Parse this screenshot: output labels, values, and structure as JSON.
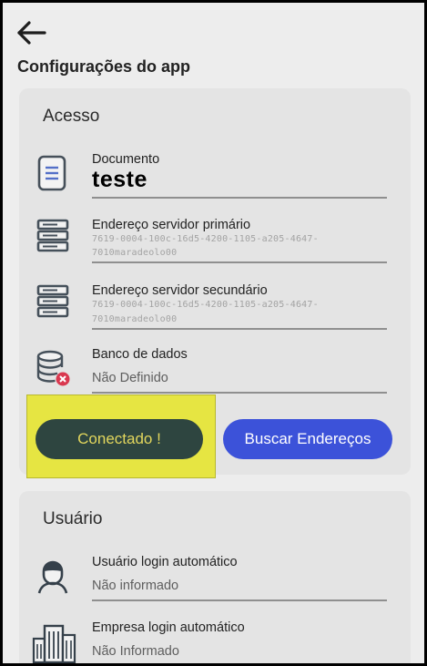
{
  "header": {
    "title": "Configurações do app"
  },
  "acesso": {
    "title": "Acesso",
    "documento": {
      "label": "Documento",
      "value": "teste"
    },
    "servidor_primario": {
      "label": "Endereço servidor primário",
      "masked_line1": "7619-0004-100c-16d5-4200-1105-a205-4647-",
      "masked_line2": "7010maradeolo00"
    },
    "servidor_secundario": {
      "label": "Endereço servidor secundário",
      "masked_line1": "7619-0004-100c-16d5-4200-1105-a205-4647-",
      "masked_line2": "7010maradeolo00"
    },
    "banco": {
      "label": "Banco de dados",
      "value": "Não Definido"
    },
    "buttons": {
      "connected": "Conectado !",
      "search": "Buscar Endereços"
    }
  },
  "usuario": {
    "title": "Usuário",
    "login_auto": {
      "label": "Usuário login automático",
      "value": "Não informado"
    },
    "empresa_auto": {
      "label": "Empresa login automático",
      "value": "Não Informado"
    }
  },
  "colors": {
    "connected_button": "#2e4540",
    "connected_text": "#e2d65d",
    "search_button": "#3c52d9",
    "highlight": "#e6e542",
    "card_bg": "#e4e4e4",
    "page_bg": "#ededed"
  },
  "icons": {
    "back": "arrow-left-icon",
    "documento": "document-icon",
    "servidor": "server-icon",
    "banco": "database-error-icon",
    "usuario": "user-icon",
    "empresa": "building-icon"
  }
}
